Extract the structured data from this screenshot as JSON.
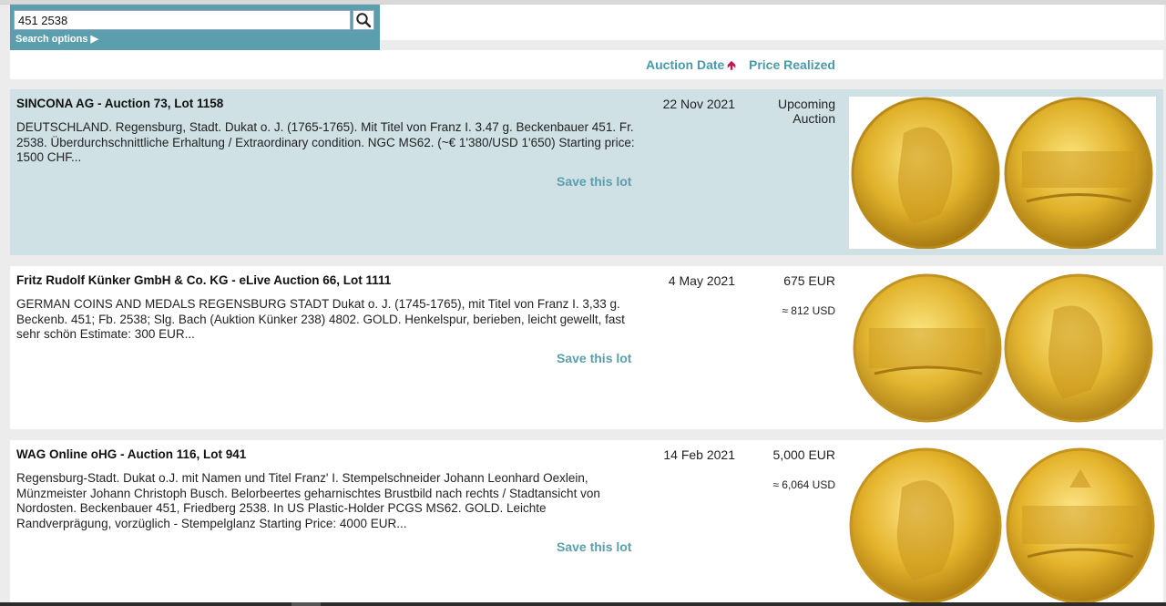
{
  "search": {
    "value": "451 2538",
    "options_label": "Search options ▶"
  },
  "sort": {
    "auction_date": "Auction Date",
    "price_realized": "Price Realized"
  },
  "lots": [
    {
      "title": "SINCONA AG - Auction 73, Lot 1158",
      "description": "DEUTSCHLAND. Regensburg, Stadt. Dukat o. J. (1765-1765). Mit Titel von Franz I. 3.47 g. Beckenbauer 451. Fr. 2538. Überdurchschnittliche Erhaltung / Extraordinary condition. NGC MS62. (~€ 1'380/USD 1'650) Starting price: 1500 CHF...",
      "date": "22 Nov 2021",
      "price": "Upcoming Auction",
      "usd": "",
      "save": "Save this lot"
    },
    {
      "title": "Fritz Rudolf Künker GmbH & Co. KG - eLive Auction 66, Lot 1111",
      "description": "GERMAN COINS AND MEDALS REGENSBURG STADT Dukat o. J. (1745-1765), mit Titel von Franz I. 3,33 g. Beckenb. 451; Fb. 2538; Slg. Bach (Auktion Künker 238) 4802. GOLD. Henkelspur, berieben, leicht gewellt, fast sehr schön Estimate: 300 EUR...",
      "date": "4 May 2021",
      "price": "675 EUR",
      "usd": "≈ 812 USD",
      "save": "Save this lot"
    },
    {
      "title": "WAG Online oHG - Auction 116, Lot 941",
      "description": "Regensburg-Stadt. Dukat o.J. mit Namen und Titel Franz' I. Stempelschneider Johann Leonhard Oexlein, Münzmeister Johann Christoph Busch. Belorbeertes geharnischtes Brustbild nach rechts / Stadtansicht von Nordosten. Beckenbauer 451, Friedberg 2538. In US Plastic-Holder PCGS MS62. GOLD. Leichte Randverprägung, vorzüglich - Stempelglanz Starting Price: 4000 EUR...",
      "date": "14 Feb 2021",
      "price": "5,000 EUR",
      "usd": "≈ 6,064 USD",
      "save": "Save this lot"
    }
  ],
  "icons": {
    "search": "magnifier-icon",
    "sort_arrow": "arrow-up-icon"
  },
  "colors": {
    "accent": "#4a9aab",
    "highlight_row": "#cfe1e4",
    "sort_arrow": "#c0144f",
    "gold": "#d9a520"
  }
}
